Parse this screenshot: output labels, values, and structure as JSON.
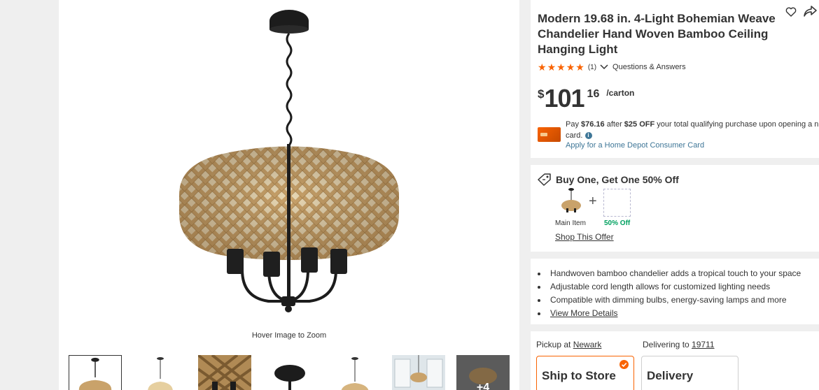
{
  "media": {
    "zoom_hint": "Hover Image to Zoom",
    "thumbnails": [
      {
        "name": "thumb-1-full-fixture",
        "active": true
      },
      {
        "name": "thumb-2-with-bulbs"
      },
      {
        "name": "thumb-3-closeup"
      },
      {
        "name": "thumb-4-canopy"
      },
      {
        "name": "thumb-5-side"
      },
      {
        "name": "thumb-6-room"
      },
      {
        "name": "thumb-7-more",
        "more_label": "+4"
      }
    ]
  },
  "product": {
    "title": "Modern 19.68 in. 4-Light Bohemian Weave Chandelier Hand Woven Bamboo Ceiling Hanging Light",
    "rating": 5,
    "rating_count": "(1)",
    "qa_label": "Questions & Answers",
    "price": {
      "currency": "$",
      "dollars": "101",
      "cents": "16",
      "unit": "/carton"
    }
  },
  "card_promo": {
    "text_prefix": "Pay ",
    "pay_amount": "$76.16",
    "text_mid": " after ",
    "discount": "$25 OFF",
    "text_suffix": " your total qualifying purchase upon opening a n",
    "text_line2": "card. ",
    "apply_link": "Apply for a Home Depot Consumer Card"
  },
  "bogo": {
    "heading": "Buy One, Get One 50% Off",
    "main_item_label": "Main Item",
    "off_label": "50% Off",
    "shop_link": "Shop This Offer"
  },
  "highlights": {
    "items": [
      "Handwoven bamboo chandelier adds a tropical touch to your space",
      "Adjustable cord length allows for customized lighting needs",
      "Compatible with dimming bulbs, energy-saving lamps and more"
    ],
    "more_link": "View More Details"
  },
  "fulfillment": {
    "pickup_prefix": "Pickup at ",
    "pickup_store": "Newark",
    "deliver_prefix": "Delivering to ",
    "deliver_zip": "19711",
    "ship_option": "Ship to Store",
    "delivery_option": "Delivery"
  },
  "colors": {
    "accent": "#f96302",
    "link": "#3e7697",
    "green": "#00a160"
  },
  "icons": [
    "heart-icon",
    "share-icon",
    "star-icon",
    "chevron-down-icon",
    "info-icon",
    "tag-icon",
    "check-icon"
  ]
}
